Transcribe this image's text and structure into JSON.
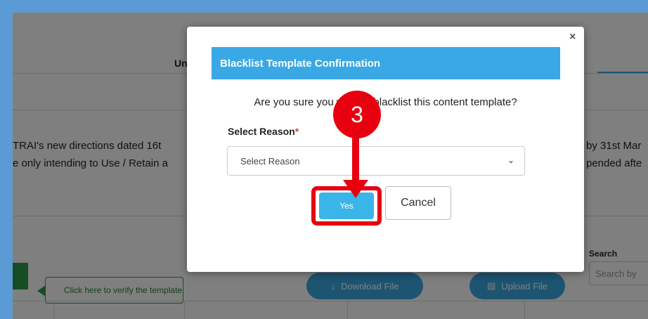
{
  "background": {
    "tab_fragment": "Un",
    "notice_left_1": "TRAI's new directions dated 16t",
    "notice_left_2": "e only intending to Use / Retain a",
    "notice_right_1": "by 31st Mar",
    "notice_right_2": "pended afte",
    "verify_label": "Click here to verify the template",
    "download_label": "Download File",
    "upload_label": "Upload File",
    "search_label": "Search",
    "search_placeholder": "Search by"
  },
  "modal": {
    "close_symbol": "×",
    "title": "Blacklist Template Confirmation",
    "question": "Are you sure you want to blacklist this content template?",
    "reason_label": "Select Reason",
    "required_mark": "*",
    "select_value": "Select Reason",
    "yes_label": "Yes",
    "cancel_label": "Cancel"
  },
  "annotation": {
    "step_number": "3"
  },
  "colors": {
    "accent": "#3aa8e4",
    "highlight": "#e8000f",
    "green": "#2e9b4a"
  }
}
